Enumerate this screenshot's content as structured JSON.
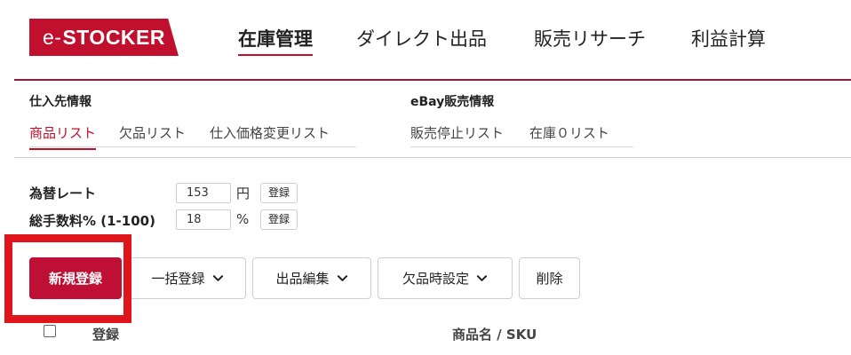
{
  "header": {
    "logo_prefix": "e-",
    "logo_main": "STOCKER",
    "nav": [
      "在庫管理",
      "ダイレクト出品",
      "販売リサーチ",
      "利益計算"
    ]
  },
  "subnav": {
    "supplier": {
      "title": "仕入先情報",
      "tabs": [
        "商品リスト",
        "欠品リスト",
        "仕入価格変更リスト"
      ]
    },
    "ebay": {
      "title": "eBay販売情報",
      "tabs": [
        "販売停止リスト",
        "在庫０リスト"
      ]
    }
  },
  "settings": {
    "exchange": {
      "label": "為替レート",
      "value": "153",
      "unit": "円",
      "button": "登録"
    },
    "fee": {
      "label": "総手数料% (1-100)",
      "value": "18",
      "unit": "%",
      "button": "登録"
    }
  },
  "actions": {
    "new": "新規登録",
    "bulk": "一括登録",
    "edit": "出品編集",
    "oos": "欠品時設定",
    "delete": "削除"
  },
  "table": {
    "col_register": "登録",
    "col_name": "商品名 / SKU"
  },
  "colors": {
    "accent": "#c0102e",
    "highlight": "#e0141b"
  }
}
